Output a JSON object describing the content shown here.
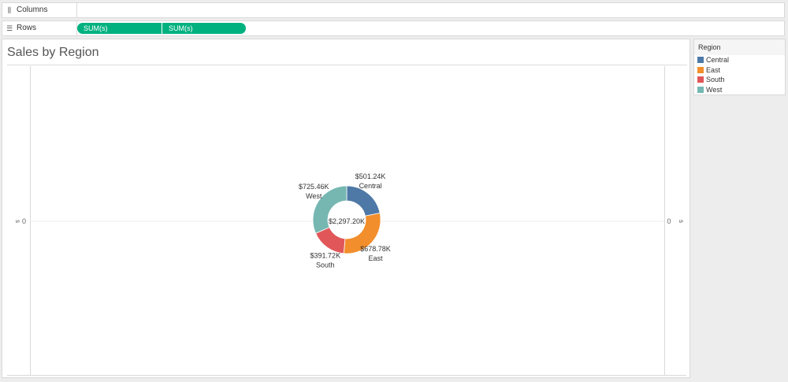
{
  "shelves": {
    "columns": {
      "label": "Columns",
      "icon": "columns-icon"
    },
    "rows": {
      "label": "Rows",
      "icon": "rows-icon",
      "pills": [
        "SUM(s)",
        "SUM(s)"
      ]
    }
  },
  "view": {
    "title": "Sales by Region",
    "axis_left": {
      "label": "s",
      "tick": "0"
    },
    "axis_right": {
      "label": "s",
      "tick": "0"
    }
  },
  "legend": {
    "title": "Region",
    "items": [
      {
        "label": "Central",
        "color": "#4e79a7"
      },
      {
        "label": "East",
        "color": "#f28e2b"
      },
      {
        "label": "South",
        "color": "#e15759"
      },
      {
        "label": "West",
        "color": "#76b7b2"
      }
    ]
  },
  "chart_data": {
    "type": "pie",
    "variant": "donut",
    "title": "Sales by Region",
    "center_label": "$2,297.20K",
    "categories": [
      "Central",
      "East",
      "South",
      "West"
    ],
    "values": [
      501.24,
      678.78,
      391.72,
      725.46
    ],
    "value_labels": [
      "$501.24K",
      "$678.78K",
      "$391.72K",
      "$725.46K"
    ],
    "colors": [
      "#4e79a7",
      "#f28e2b",
      "#e15759",
      "#76b7b2"
    ],
    "legend": "right"
  }
}
